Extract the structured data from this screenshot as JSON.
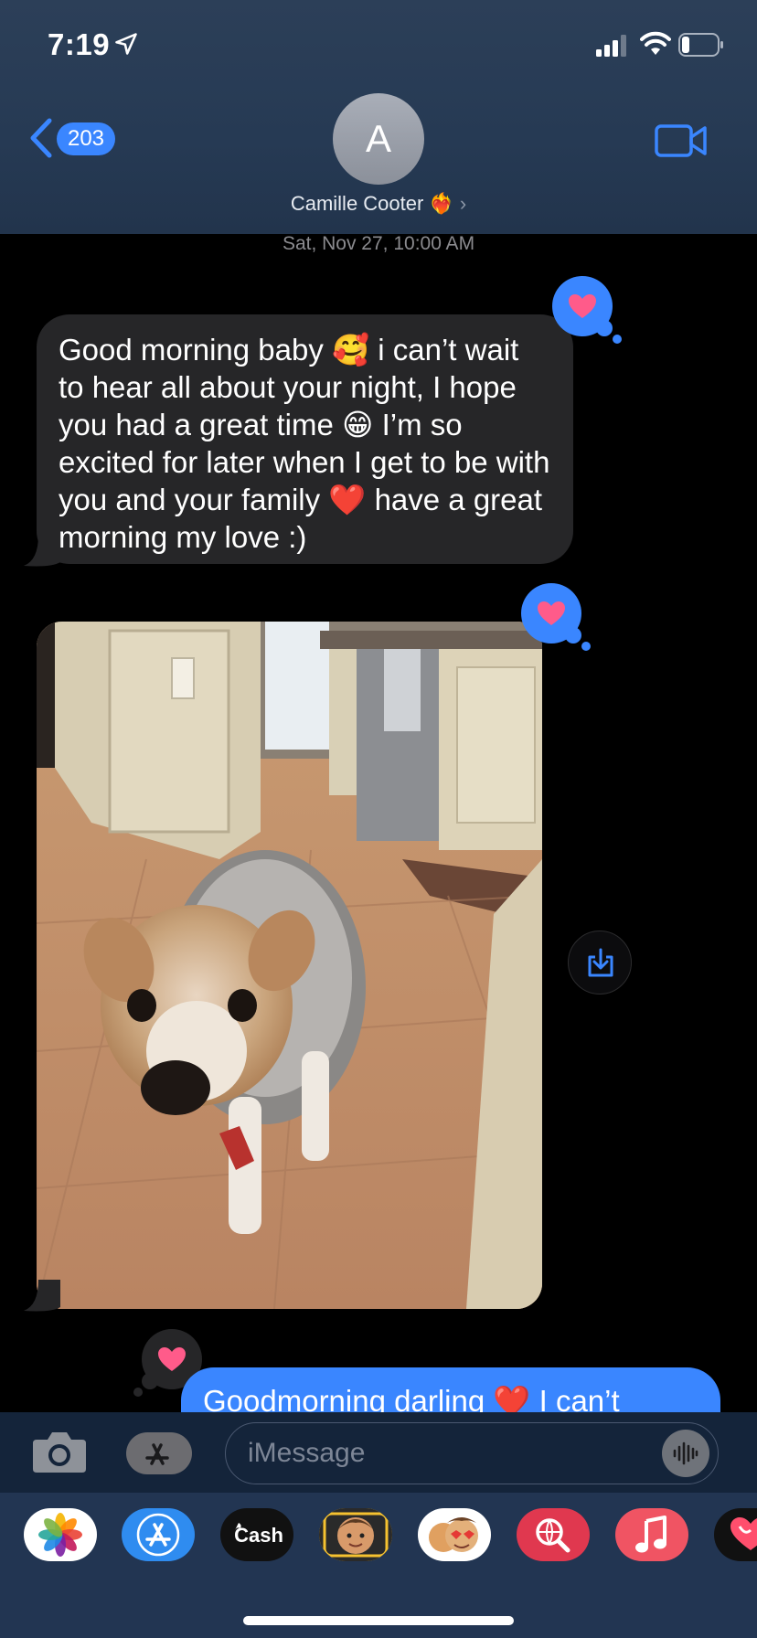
{
  "status_bar": {
    "time": "7:19"
  },
  "header": {
    "back_count": "203",
    "avatar_initial": "A",
    "contact_name": "Camille Cooter ❤️‍🔥",
    "contact_chevron": "›"
  },
  "conversation": {
    "timestamp": "Sat, Nov 27, 10:00 AM",
    "incoming_message_1": "Good morning baby 🥰 i can’t wait to hear all about your night, I hope you had a great time 😁 I’m so excited for later when I get to be with you and your family ❤️ have a great morning my love :)",
    "outgoing_message_1": "Goodmorning darling ❤️ I can’t"
  },
  "composer": {
    "placeholder": "iMessage"
  },
  "app_drawer": {
    "apps": [
      {
        "name": "photos-app",
        "label": ""
      },
      {
        "name": "app-store-app",
        "label": ""
      },
      {
        "name": "cash-app",
        "label": "Cash"
      },
      {
        "name": "memoji-stickers-app",
        "label": ""
      },
      {
        "name": "animoji-app",
        "label": ""
      },
      {
        "name": "images-search-app",
        "label": ""
      },
      {
        "name": "music-app",
        "label": ""
      },
      {
        "name": "digital-touch-app",
        "label": ""
      }
    ],
    "cash_label": "Cash"
  },
  "colors": {
    "accent_blue": "#3a86ff",
    "incoming_bubble": "#262628",
    "tapback_heart": "#ff5b8a"
  }
}
